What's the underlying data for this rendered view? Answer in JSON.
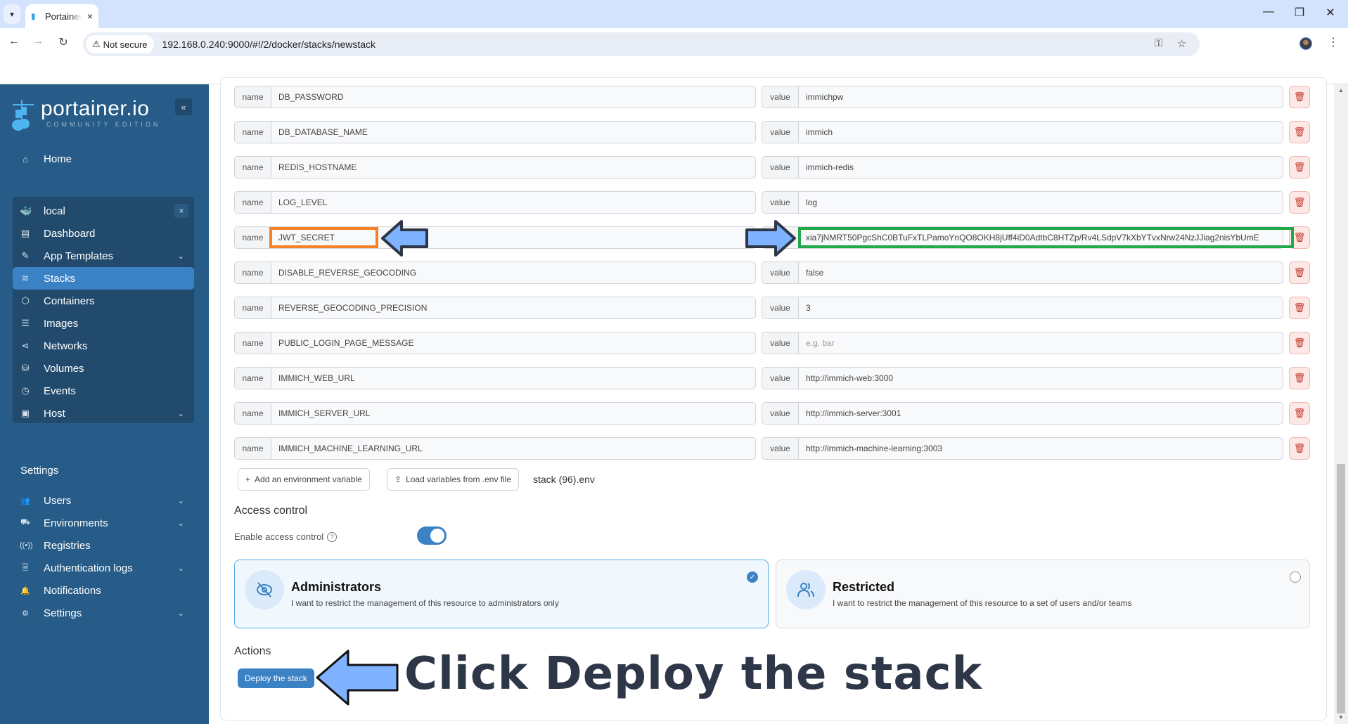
{
  "browser": {
    "tab_title": "Portainer.io",
    "tab_close": "×",
    "security_label": "Not secure",
    "url": "192.168.0.240:9000/#!/2/docker/stacks/newstack",
    "icons": {
      "tab_menu": "▾",
      "back": "←",
      "forward": "→",
      "reload": "↻",
      "warning": "⚠",
      "key": "⚿",
      "star": "☆",
      "kebab": "⋮",
      "minimize": "—",
      "restore": "❐",
      "close": "✕"
    }
  },
  "sidebar": {
    "logo_main": "portainer.io",
    "logo_sub": "COMMUNITY EDITION",
    "collapse_icon": "«",
    "home": {
      "label": "Home",
      "icon": "⌂"
    },
    "environment": {
      "name": "local",
      "icon": "🐳",
      "close": "×",
      "items": [
        {
          "label": "Dashboard",
          "icon": "▤",
          "chevron": false,
          "active": false
        },
        {
          "label": "App Templates",
          "icon": "✎",
          "chevron": true,
          "active": false
        },
        {
          "label": "Stacks",
          "icon": "≋",
          "chevron": false,
          "active": true
        },
        {
          "label": "Containers",
          "icon": "⬡",
          "chevron": false,
          "active": false
        },
        {
          "label": "Images",
          "icon": "☰",
          "chevron": false,
          "active": false
        },
        {
          "label": "Networks",
          "icon": "⋖",
          "chevron": false,
          "active": false
        },
        {
          "label": "Volumes",
          "icon": "⛁",
          "chevron": false,
          "active": false
        },
        {
          "label": "Events",
          "icon": "◷",
          "chevron": false,
          "active": false
        },
        {
          "label": "Host",
          "icon": "▣",
          "chevron": true,
          "active": false
        }
      ]
    },
    "settings_heading": "Settings",
    "settings_items": [
      {
        "label": "Users",
        "icon": "👥",
        "chevron": true
      },
      {
        "label": "Environments",
        "icon": "⛟",
        "chevron": true
      },
      {
        "label": "Registries",
        "icon": "((•))",
        "chevron": false
      },
      {
        "label": "Authentication logs",
        "icon": "🗎",
        "chevron": true
      },
      {
        "label": "Notifications",
        "icon": "🔔",
        "chevron": false
      },
      {
        "label": "Settings",
        "icon": "⚙",
        "chevron": true
      }
    ],
    "chevron_icon": "⌄"
  },
  "env_vars": {
    "name_label": "name",
    "value_label": "value",
    "trash_icon": "🗑",
    "rows": [
      {
        "name": "DB_PASSWORD",
        "value": "immichpw",
        "placeholder": false
      },
      {
        "name": "DB_DATABASE_NAME",
        "value": "immich",
        "placeholder": false
      },
      {
        "name": "REDIS_HOSTNAME",
        "value": "immich-redis",
        "placeholder": false
      },
      {
        "name": "LOG_LEVEL",
        "value": "log",
        "placeholder": false
      },
      {
        "name": "JWT_SECRET",
        "value": "xia7jNMRT50PgcShC0BTuFxTLPamoYnQO8OKH8jUff4iD0AdtbC8HTZp/Rv4LSdpV7kXbYTvxNrw24NzJJiag2nisYbUmE",
        "placeholder": false
      },
      {
        "name": "DISABLE_REVERSE_GEOCODING",
        "value": "false",
        "placeholder": false
      },
      {
        "name": "REVERSE_GEOCODING_PRECISION",
        "value": "3",
        "placeholder": false
      },
      {
        "name": "PUBLIC_LOGIN_PAGE_MESSAGE",
        "value": "e.g. bar",
        "placeholder": true
      },
      {
        "name": "IMMICH_WEB_URL",
        "value": "http://immich-web:3000",
        "placeholder": false
      },
      {
        "name": "IMMICH_SERVER_URL",
        "value": "http://immich-server:3001",
        "placeholder": false
      },
      {
        "name": "IMMICH_MACHINE_LEARNING_URL",
        "value": "http://immich-machine-learning:3003",
        "placeholder": false
      }
    ],
    "add_button": "Add an environment variable",
    "add_icon": "+",
    "load_button": "Load variables from .env file",
    "load_icon": "⇪",
    "loaded_file": "stack (96).env"
  },
  "access_control": {
    "heading": "Access control",
    "toggle_label": "Enable access control",
    "help_icon": "?",
    "enabled": true,
    "options": [
      {
        "title": "Administrators",
        "description": "I want to restrict the management of this resource to administrators only",
        "icon": "⊘",
        "selected": true
      },
      {
        "title": "Restricted",
        "description": "I want to restrict the management of this resource to a set of users and/or teams",
        "icon": "👥",
        "selected": false
      }
    ],
    "check_icon": "✓"
  },
  "actions": {
    "heading": "Actions",
    "deploy_button": "Deploy the stack"
  },
  "annotation": {
    "text": "Click Deploy the stack",
    "highlight_colors": {
      "name": "#f5822a",
      "value": "#22a94a",
      "arrow": "#7fb2ff"
    }
  },
  "scrollbar": {
    "up": "▲",
    "down": "▼"
  }
}
